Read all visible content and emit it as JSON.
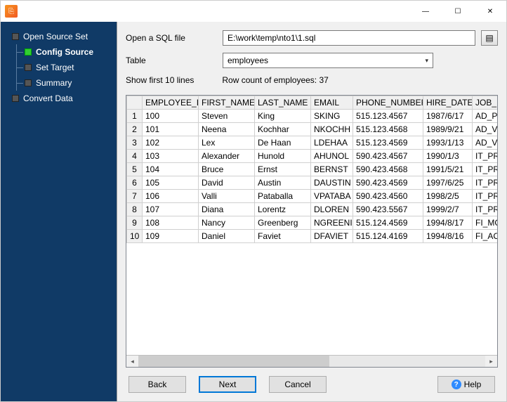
{
  "window": {
    "minimize": "—",
    "maximize": "☐",
    "close": "✕"
  },
  "sidebar": {
    "items": [
      {
        "label": "Open Source Set",
        "active": false,
        "child": false
      },
      {
        "label": "Config Source",
        "active": true,
        "child": true
      },
      {
        "label": "Set Target",
        "active": false,
        "child": true
      },
      {
        "label": "Summary",
        "active": false,
        "child": true
      },
      {
        "label": "Convert Data",
        "active": false,
        "child": false
      }
    ]
  },
  "form": {
    "open_sql_label": "Open a SQL file",
    "sql_path": "E:\\work\\temp\\nto1\\1.sql",
    "table_label": "Table",
    "table_value": "employees",
    "show_first": "Show first 10 lines",
    "row_count": "Row count of employees: 37"
  },
  "table": {
    "columns": [
      "EMPLOYEE_ID",
      "FIRST_NAME",
      "LAST_NAME",
      "EMAIL",
      "PHONE_NUMBER",
      "HIRE_DATE",
      "JOB_ID"
    ],
    "rows": [
      {
        "n": "1",
        "employee_id": "100",
        "first_name": "Steven",
        "last_name": "King",
        "email": "SKING",
        "phone": "515.123.4567",
        "hire_date": "1987/6/17",
        "job_id": "AD_PRE"
      },
      {
        "n": "2",
        "employee_id": "101",
        "first_name": "Neena",
        "last_name": "Kochhar",
        "email": "NKOCHH",
        "phone": "515.123.4568",
        "hire_date": "1989/9/21",
        "job_id": "AD_VP"
      },
      {
        "n": "3",
        "employee_id": "102",
        "first_name": "Lex",
        "last_name": "De Haan",
        "email": "LDEHAA",
        "phone": "515.123.4569",
        "hire_date": "1993/1/13",
        "job_id": "AD_VP"
      },
      {
        "n": "4",
        "employee_id": "103",
        "first_name": "Alexander",
        "last_name": "Hunold",
        "email": "AHUNOL",
        "phone": "590.423.4567",
        "hire_date": "1990/1/3",
        "job_id": "IT_PROG"
      },
      {
        "n": "5",
        "employee_id": "104",
        "first_name": "Bruce",
        "last_name": "Ernst",
        "email": "BERNST",
        "phone": "590.423.4568",
        "hire_date": "1991/5/21",
        "job_id": "IT_PROG"
      },
      {
        "n": "6",
        "employee_id": "105",
        "first_name": "David",
        "last_name": "Austin",
        "email": "DAUSTIN",
        "phone": "590.423.4569",
        "hire_date": "1997/6/25",
        "job_id": "IT_PROG"
      },
      {
        "n": "7",
        "employee_id": "106",
        "first_name": "Valli",
        "last_name": "Pataballa",
        "email": "VPATABA",
        "phone": "590.423.4560",
        "hire_date": "1998/2/5",
        "job_id": "IT_PROG"
      },
      {
        "n": "8",
        "employee_id": "107",
        "first_name": "Diana",
        "last_name": "Lorentz",
        "email": "DLOREN",
        "phone": "590.423.5567",
        "hire_date": "1999/2/7",
        "job_id": "IT_PROG"
      },
      {
        "n": "9",
        "employee_id": "108",
        "first_name": "Nancy",
        "last_name": "Greenberg",
        "email": "NGREENI",
        "phone": "515.124.4569",
        "hire_date": "1994/8/17",
        "job_id": "FI_MGR"
      },
      {
        "n": "10",
        "employee_id": "109",
        "first_name": "Daniel",
        "last_name": "Faviet",
        "email": "DFAVIET",
        "phone": "515.124.4169",
        "hire_date": "1994/8/16",
        "job_id": "FI_ACCO"
      }
    ]
  },
  "buttons": {
    "back": "Back",
    "next": "Next",
    "cancel": "Cancel",
    "help": "Help"
  }
}
